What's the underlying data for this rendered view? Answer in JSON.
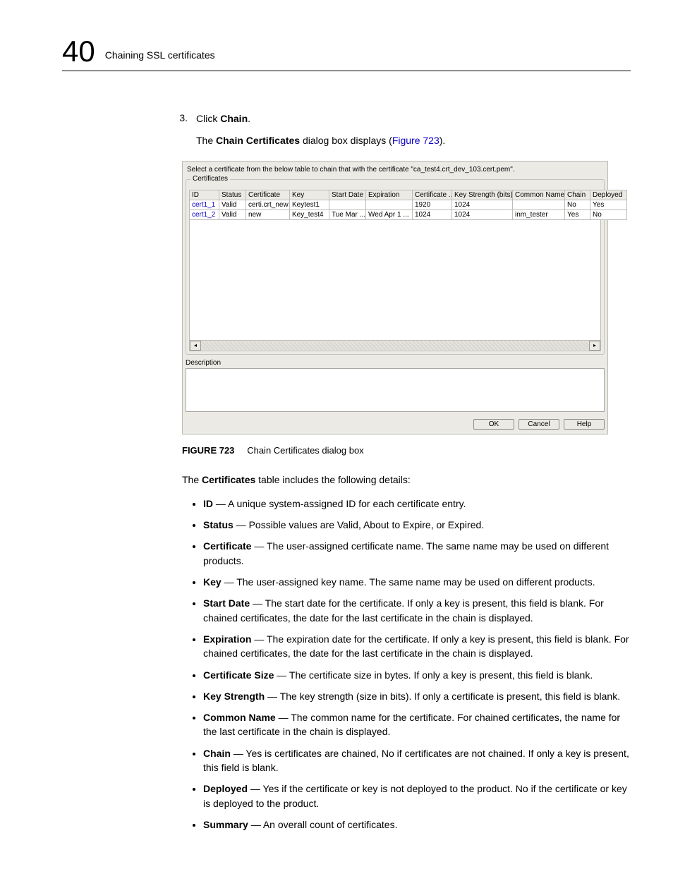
{
  "chapter": {
    "number": "40",
    "title": "Chaining SSL certificates"
  },
  "step": {
    "number": "3.",
    "prefix": "Click ",
    "action": "Chain",
    "suffix": ".",
    "sub_pre": "The ",
    "sub_bold": "Chain Certificates",
    "sub_mid": " dialog box displays (",
    "sub_link": "Figure 723",
    "sub_post": ")."
  },
  "dialog": {
    "instruction": "Select a certificate from the below table to chain that with the certificate \"ca_test4.crt_dev_103.cert.pem\".",
    "group_label": "Certificates",
    "columns": [
      "ID",
      "Status",
      "Certificate",
      "Key",
      "Start Date",
      "Expiration",
      "Certificate ...",
      "Key Strength (bits)",
      "Common Name",
      "Chain",
      "Deployed"
    ],
    "rows": [
      {
        "id": "cert1_1",
        "status": "Valid",
        "cert": "certi.crt_new",
        "key": "Keytest1",
        "start": "",
        "exp": "",
        "csize": "1920",
        "kbits": "1024",
        "cn": "",
        "chain": "No",
        "deployed": "Yes"
      },
      {
        "id": "cert1_2",
        "status": "Valid",
        "cert": "new",
        "key": "Key_test4",
        "start": "Tue Mar ...",
        "exp": "Wed Apr 1 ...",
        "csize": "1024",
        "kbits": "1024",
        "cn": "inm_tester",
        "chain": "Yes",
        "deployed": "No"
      }
    ],
    "desc_label": "Description",
    "buttons": {
      "ok": "OK",
      "cancel": "Cancel",
      "help": "Help"
    }
  },
  "figure": {
    "label": "FIGURE 723",
    "text": "Chain Certificates dialog box"
  },
  "table_intro": {
    "pre": "The ",
    "bold": "Certificates",
    "post": " table includes the following details:"
  },
  "bullets": [
    {
      "label": "ID",
      "text": " — A unique system-assigned ID for each certificate entry."
    },
    {
      "label": "Status",
      "text": " — Possible values are Valid, About to Expire, or Expired."
    },
    {
      "label": "Certificate",
      "text": " — The user-assigned certificate name. The same name may be used on different products."
    },
    {
      "label": "Key",
      "text": " — The user-assigned key name. The same name may be used on different products."
    },
    {
      "label": "Start Date",
      "text": " — The start date for the certificate. If only a key is present, this field is blank. For chained certificates, the date for the last certificate in the chain is displayed."
    },
    {
      "label": "Expiration",
      "text": " — The expiration date for the certificate. If only a key is present, this field is blank. For chained certificates, the date for the last certificate in the chain is displayed."
    },
    {
      "label": "Certificate Size",
      "text": " — The certificate size in bytes. If only a key is present, this field is blank."
    },
    {
      "label": "Key Strength",
      "text": " — The key strength (size in bits). If only a certificate is present, this field is blank."
    },
    {
      "label": "Common Name",
      "text": " — The common name for the certificate. For chained certificates, the name for the last certificate in the chain is displayed."
    },
    {
      "label": "Chain",
      "text": " — Yes is certificates are chained, No if certificates are not chained. If only a key is present, this field is blank."
    },
    {
      "label": "Deployed",
      "text": " — Yes if the certificate or key is not deployed to the product. No if the certificate or key is deployed to the product."
    },
    {
      "label": "Summary",
      "text": " — An overall count of certificates."
    }
  ]
}
